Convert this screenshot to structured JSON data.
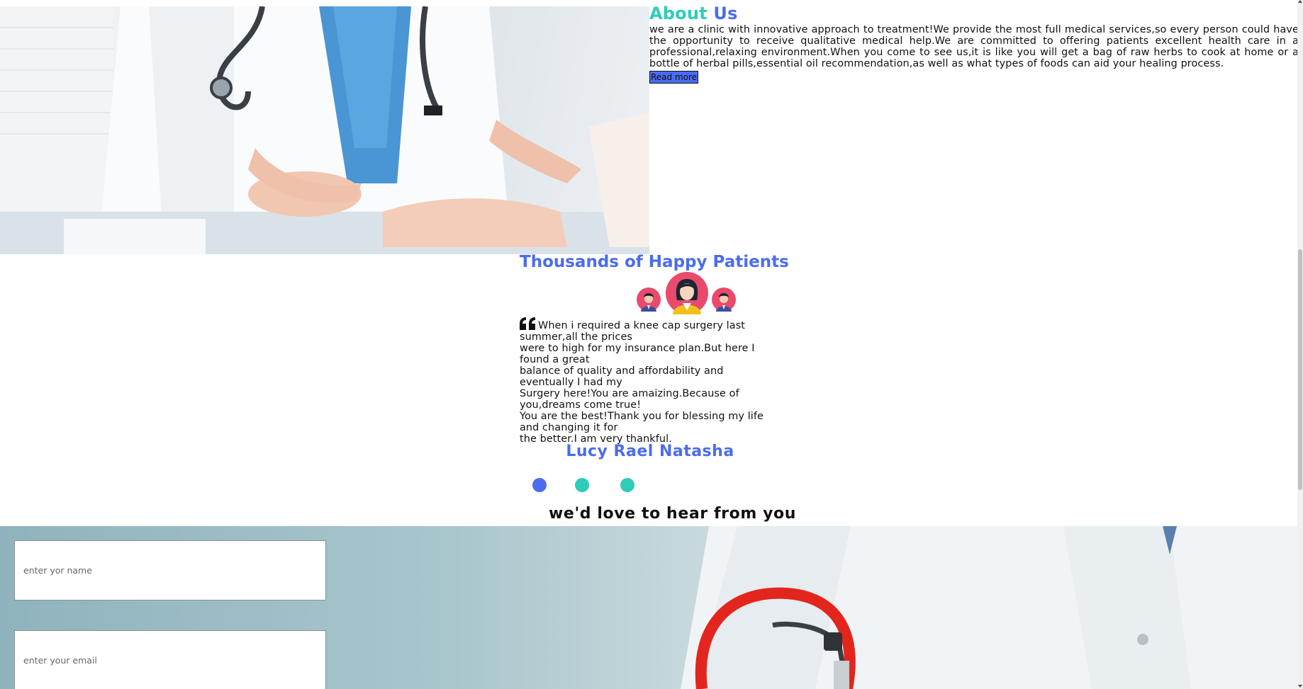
{
  "about": {
    "title_part1": "About",
    "title_part2": "Us",
    "body": "we are a clinic with innovative approach to treatment!We provide the most full medical services,so every person could have the opportunity to receive qualitative medical help.We are committed to offering patients excellent health care in a professional,relaxing environment.When you come to see us,it is like you will get a bag of raw herbs to cook at home or a bottle of herbal pills,essential oil recommendation,as well as what types of foods can aid your healing process.",
    "read_more_label": "Read more"
  },
  "testimonials": {
    "title": "Thousands of Happy Patients",
    "quote_lines": [
      "When i required a knee cap surgery last summer,all the prices",
      "were to high for my insurance plan.But here I found a great",
      "balance of quality and affordability and eventually I had my",
      "Surgery here!You are amaizing.Because of you,dreams come true!",
      "You are the best!Thank you for blessing my life and changing it for",
      "the better.I am very thankful."
    ],
    "author": "Lucy Rael Natasha",
    "dots": [
      {
        "color": "#4a6cf0",
        "active": true
      },
      {
        "color": "#2ecdb8",
        "active": false
      },
      {
        "color": "#2ecdb8",
        "active": false
      }
    ]
  },
  "contact": {
    "heading": "we'd love to hear from you",
    "name_placeholder": "enter yor name",
    "email_placeholder": "enter your email"
  },
  "colors": {
    "accent_blue": "#4a6cf0",
    "accent_teal": "#2ecdb8",
    "avatar_bg": "#e94a6b"
  },
  "icons": {
    "quote": "quote-icon",
    "avatar_male": "male-avatar-icon",
    "avatar_female": "female-avatar-icon"
  }
}
